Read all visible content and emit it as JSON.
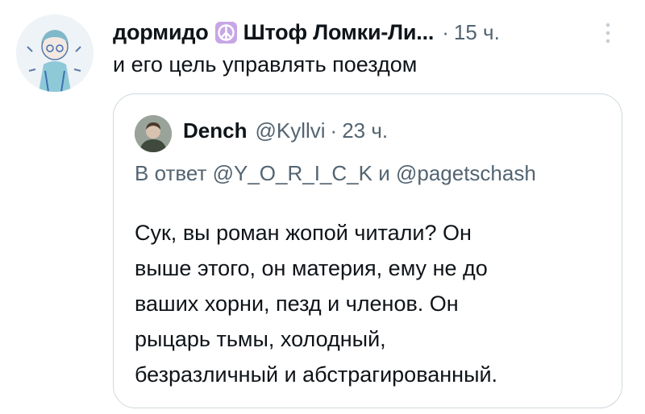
{
  "tweet": {
    "author": {
      "display_name": "дормидо",
      "name_suffix": "Штоф Ломки-Ли...",
      "badge_icon": "peace-symbol-icon"
    },
    "separator": "·",
    "time": "15 ч.",
    "text": "и его цель управлять поездом",
    "more_icon": "vertical-dots-icon"
  },
  "quote": {
    "author": {
      "display_name": "Dench",
      "handle": "@Kyllvi"
    },
    "separator": "·",
    "time": "23 ч.",
    "reply_to": "В ответ @Y_O_R_I_C_K и @pagetschash",
    "body_lines": [
      "Сук, вы роман жопой читали? Он",
      "выше этого, он материя, ему не до",
      "ваших хорни, пезд и членов. Он",
      "рыцарь тьмы, холодный,",
      "безразличный и абстрагированный."
    ]
  },
  "colors": {
    "text_primary": "#0f1419",
    "text_secondary": "#536471",
    "border": "#cfd9de",
    "badge_bg": "#c7a6e6"
  }
}
